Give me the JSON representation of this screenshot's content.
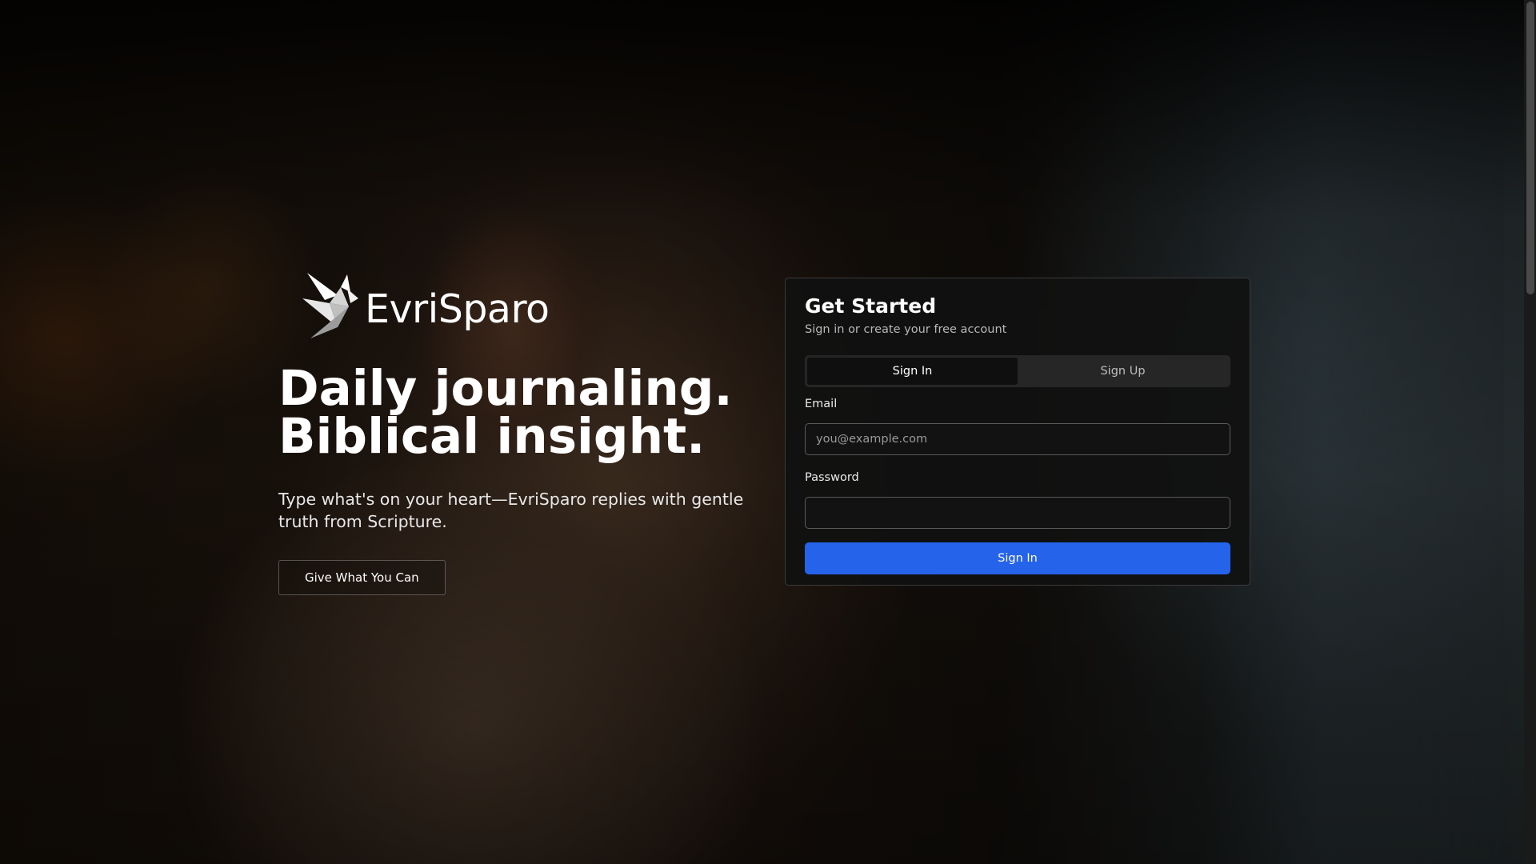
{
  "brand": {
    "name": "EvriSparo",
    "logo_icon": "bird-origami-icon"
  },
  "hero": {
    "headline_line1": "Daily journaling.",
    "headline_line2": "Biblical insight.",
    "subtext": "Type what's on your heart—EvriSparo replies with gentle truth from Scripture.",
    "cta_label": "Give What You Can"
  },
  "auth": {
    "title": "Get Started",
    "subtitle": "Sign in or create your free account",
    "tabs": [
      {
        "label": "Sign In",
        "active": true
      },
      {
        "label": "Sign Up",
        "active": false
      }
    ],
    "email_label": "Email",
    "email_placeholder": "you@example.com",
    "email_value": "",
    "password_label": "Password",
    "password_value": "",
    "submit_label": "Sign In"
  },
  "colors": {
    "primary": "#2563eb",
    "card_background": "#111111"
  }
}
